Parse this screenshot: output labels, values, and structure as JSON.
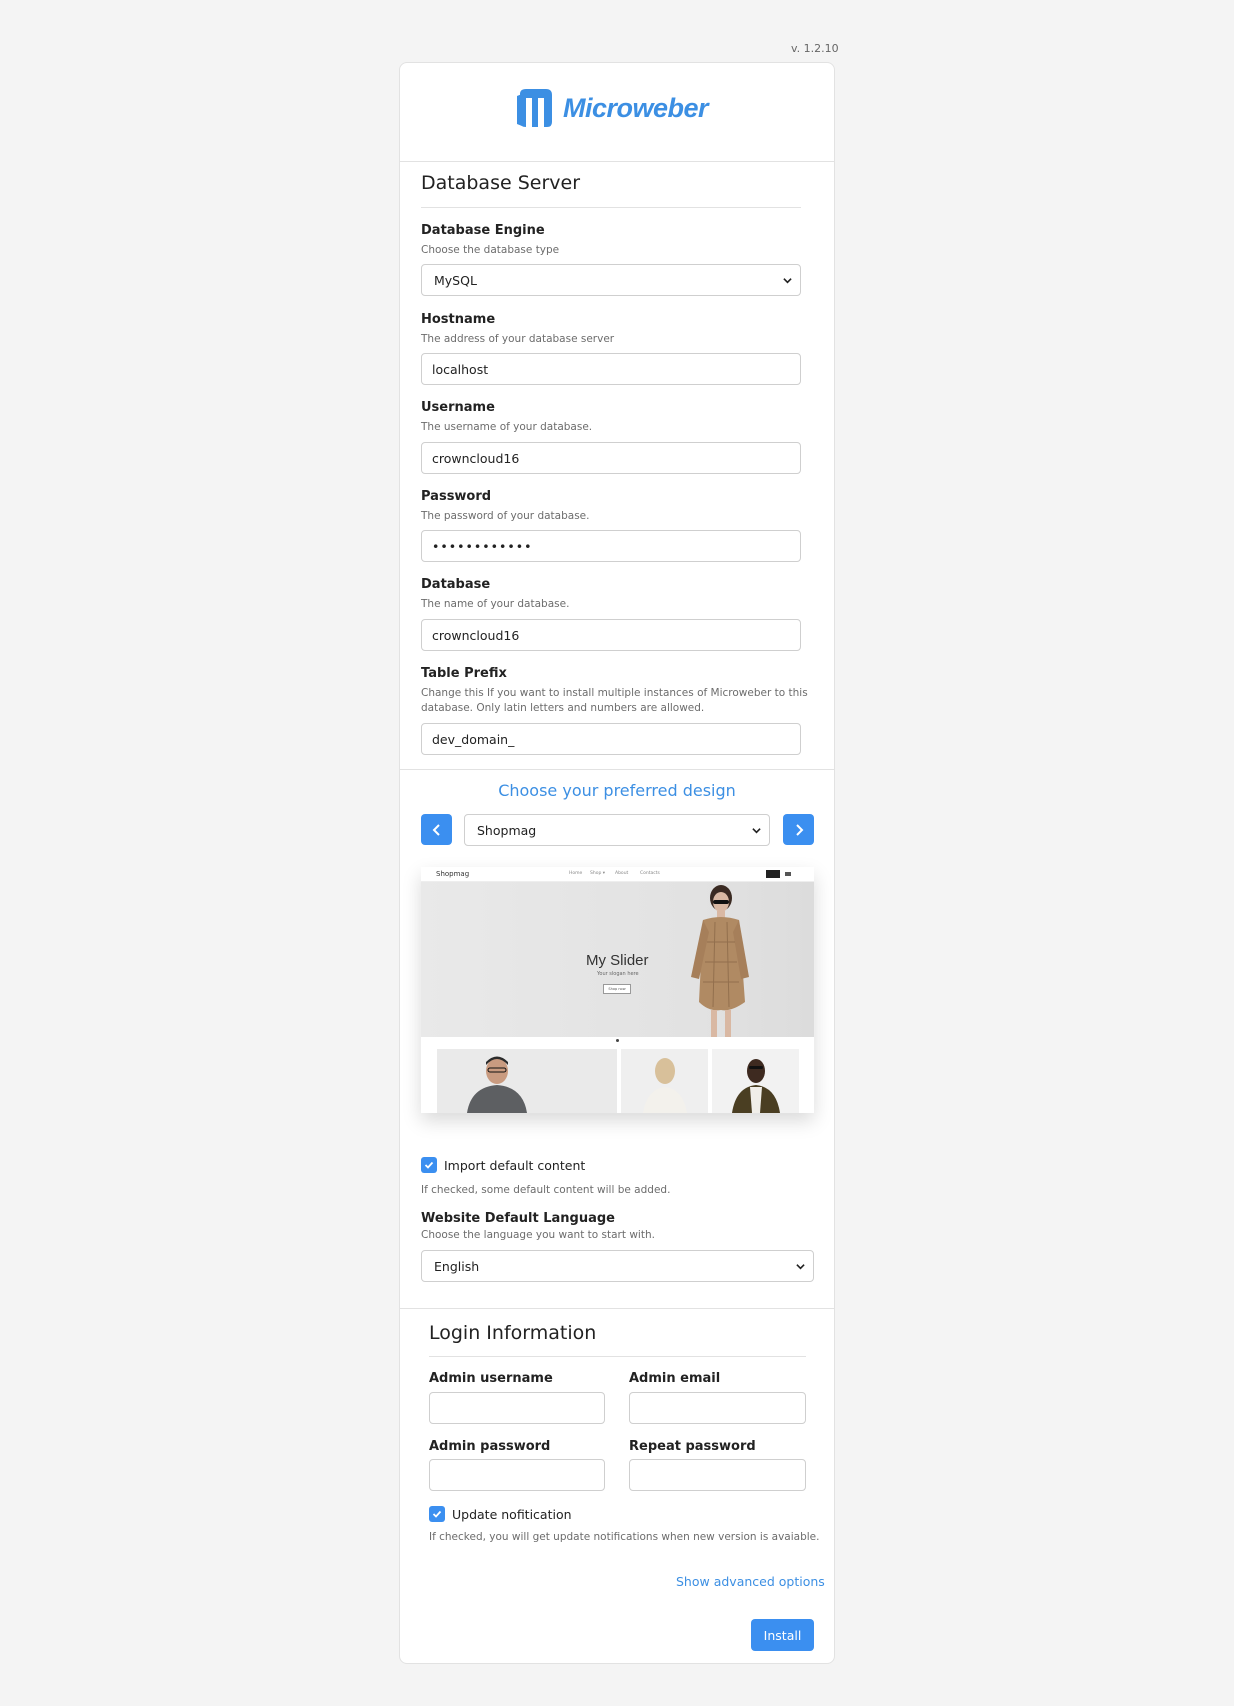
{
  "version": "v. 1.2.10",
  "logo": {
    "text": "Microweber",
    "color": "#3c8fe3"
  },
  "database": {
    "title": "Database Server",
    "engine": {
      "label": "Database Engine",
      "help": "Choose the database type",
      "value": "MySQL"
    },
    "hostname": {
      "label": "Hostname",
      "help": "The address of your database server",
      "value": "localhost"
    },
    "username": {
      "label": "Username",
      "help": "The username of your database.",
      "value": "crowncloud16"
    },
    "password": {
      "label": "Password",
      "help": "The password of your database.",
      "value": "••••••••••••"
    },
    "database": {
      "label": "Database",
      "help": "The name of your database.",
      "value": "crowncloud16"
    },
    "prefix": {
      "label": "Table Prefix",
      "help_line1": "Change this If you want to install multiple instances of Microweber to this",
      "help_line2": "database. Only latin letters and numbers are allowed.",
      "value": "dev_domain_"
    }
  },
  "design": {
    "title": "Choose your preferred design",
    "selected": "Shopmag",
    "prev_icon": "chevron-left-icon",
    "next_icon": "chevron-right-icon",
    "preview": {
      "brand": "Shopmag",
      "menu": [
        "Home",
        "Shop ▾",
        "About",
        "Contacts"
      ],
      "slider_title": "My Slider",
      "slider_slogan": "Your slogan here",
      "slider_button": "Shop now"
    }
  },
  "import_content": {
    "checked": true,
    "label": "Import default content",
    "help": "If checked, some default content will be added."
  },
  "language": {
    "label": "Website Default Language",
    "help": "Choose the language you want to start with.",
    "value": "English"
  },
  "login": {
    "title": "Login Information",
    "admin_username": {
      "label": "Admin username",
      "value": ""
    },
    "admin_email": {
      "label": "Admin email",
      "value": ""
    },
    "admin_password": {
      "label": "Admin password",
      "value": ""
    },
    "repeat_password": {
      "label": "Repeat password",
      "value": ""
    }
  },
  "update_notification": {
    "checked": true,
    "label": "Update nofitication",
    "help": "If checked, you will get update notifications when new version is avaiable."
  },
  "advanced_link": "Show advanced options",
  "install_button": "Install",
  "colors": {
    "accent": "#3b8ff0",
    "link": "#3c8fe3",
    "background": "#f4f4f4"
  }
}
